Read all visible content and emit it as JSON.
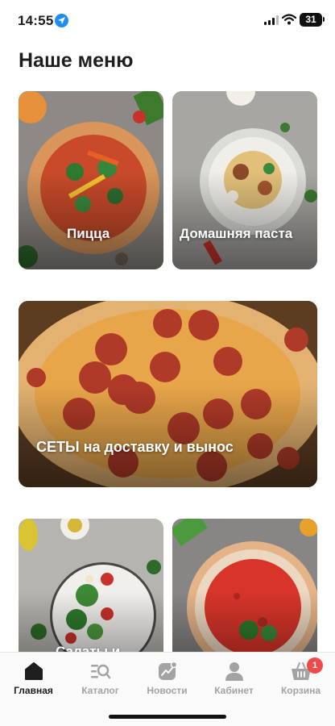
{
  "status_bar": {
    "time": "14:55",
    "battery": "31"
  },
  "page": {
    "title": "Наше меню"
  },
  "tiles": [
    {
      "label": "Пицца"
    },
    {
      "label": "Домашняя паста"
    },
    {
      "label": "СЕТЫ на доставку и вынос"
    },
    {
      "label": "Салаты и"
    },
    {
      "label": ""
    }
  ],
  "tab_bar": {
    "items": [
      {
        "label": "Главная",
        "icon": "home-icon",
        "active": true
      },
      {
        "label": "Каталог",
        "icon": "catalog-search-icon"
      },
      {
        "label": "Новости",
        "icon": "news-chart-icon"
      },
      {
        "label": "Кабинет",
        "icon": "user-icon"
      },
      {
        "label": "Корзина",
        "icon": "basket-icon",
        "badge": "1"
      }
    ]
  },
  "colors": {
    "accent": "#1e1e1e",
    "inactive": "#a3a3a3",
    "badge": "#ee4a4a",
    "location": "#1f8ef1"
  }
}
